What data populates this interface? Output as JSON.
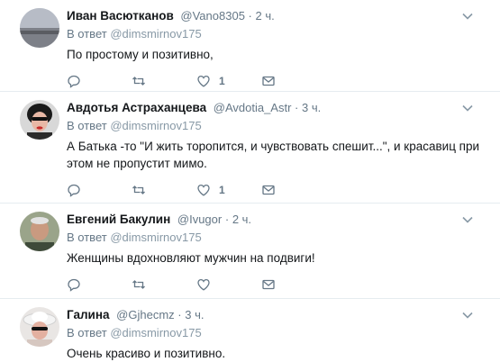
{
  "tweets": [
    {
      "name": "Иван Васютканов",
      "handle": "@Vano8305",
      "time": "2 ч.",
      "reply_prefix": "В ответ",
      "reply_user": "@dimsmirnov175",
      "text": "По простому и позитивно,",
      "like_count": "1",
      "avatar": "landscape-avatar"
    },
    {
      "name": "Авдотья Астраханцева",
      "handle": "@Avdotia_Astr",
      "time": "3 ч.",
      "reply_prefix": "В ответ",
      "reply_user": "@dimsmirnov175",
      "text": "А Батька -то \"И жить торопится, и чувствовать спешит...\", и красавиц при этом не пропустит мимо.",
      "like_count": "1",
      "avatar": "woman-avatar"
    },
    {
      "name": "Евгений Бакулин",
      "handle": "@Ivugor",
      "time": "2 ч.",
      "reply_prefix": "В ответ",
      "reply_user": "@dimsmirnov175",
      "text": "Женщины вдохновляют мужчин на подвиги!",
      "like_count": "",
      "avatar": "man-avatar"
    },
    {
      "name": "Галина",
      "handle": "@Gjhecmz",
      "time": "3 ч.",
      "reply_prefix": "В ответ",
      "reply_user": "@dimsmirnov175",
      "text": "Очень красиво и позитивно.",
      "like_count": "",
      "avatar": "hat-woman-avatar"
    }
  ],
  "separator": "·",
  "colors": {
    "accent": "#1da1f2",
    "muted": "#657786",
    "border": "#e6ecf0"
  }
}
